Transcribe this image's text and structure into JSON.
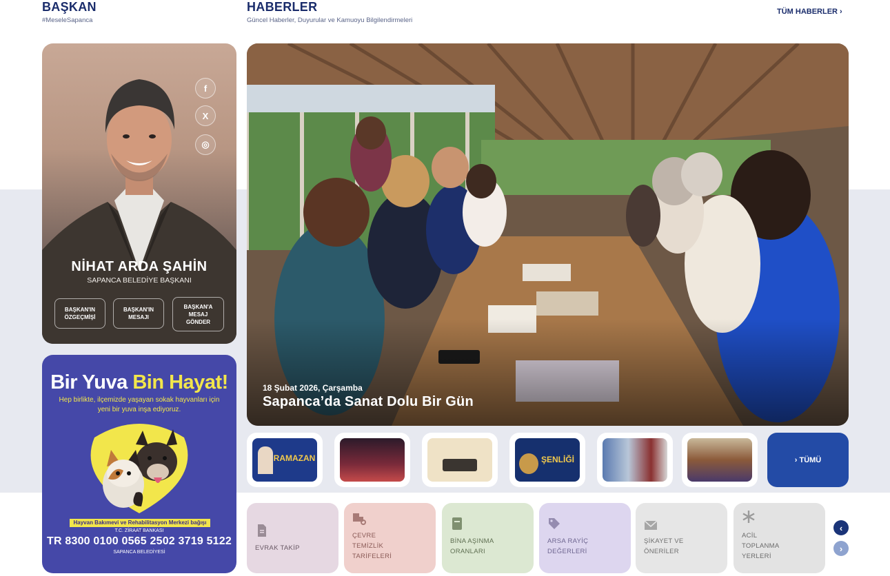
{
  "mayor_section": {
    "title": "BAŞKAN",
    "subtitle": "#MeseleSapanca"
  },
  "news_section": {
    "title": "HABERLER",
    "subtitle": "Güncel Haberler, Duyurular ve Kamuoyu Bilgilendirmeleri",
    "all_news_label": "TÜM HABERLER ›"
  },
  "mayor": {
    "name": "NİHAT ARDA ŞAHİN",
    "role": "SAPANCA BELEDİYE BAŞKANI",
    "social": {
      "facebook": "f",
      "x": "X",
      "instagram": "◎"
    },
    "buttons": [
      "BAŞKAN'IN\nÖZGEÇMİŞİ",
      "BAŞKAN'IN\nMESAJI",
      "BAŞKAN'A\nMESAJ\nGÖNDER"
    ]
  },
  "promo": {
    "title_part1": "Bir Yuva",
    "title_part2": "Bin Hayat!",
    "description": "Hep birlikte, ilçemizde yaşayan sokak hayvanları için yeni bir yuva inşa ediyoruz.",
    "footer_note": "Hayvan Bakımevi ve Rehabilitasyon Merkezi bağışı için;",
    "bank": "T.C. ZİRAAT BANKASI",
    "iban": "TR 8300 0100 0565 2502 3719 5122",
    "municipality": "SAPANCA BELEDİYESİ"
  },
  "hero": {
    "date": "18 Şubat 2026, Çarşamba",
    "title": "Sapanca’da Sanat Dolu Bir Gün"
  },
  "thumbnails": {
    "t1": "RAMAZAN",
    "t4": "ŞENLİĞİ",
    "more_label": "›  TÜMÜ"
  },
  "quick_links": [
    {
      "label": "EVRAK TAKİP",
      "icon": "document-icon"
    },
    {
      "label": "ÇEVRE\nTEMİZLİK\nTARİFELERİ",
      "icon": "truck-icon"
    },
    {
      "label": "BİNA AŞINMA\nORANLARI",
      "icon": "book-icon"
    },
    {
      "label": "ARSA RAYİÇ\nDEĞERLERİ",
      "icon": "tag-icon"
    },
    {
      "label": "ŞİKAYET VE\nÖNERİLER",
      "icon": "envelope-icon"
    },
    {
      "label": "ACİL\nTOPLANMA\nYERLERİ",
      "icon": "asterisk-icon"
    }
  ],
  "arrows": {
    "prev": "‹",
    "next": "›"
  },
  "colors": {
    "navy": "#1a2c6b",
    "band": "#e7e9f0",
    "promo": "#4548a8",
    "promo_accent": "#f2e64b",
    "more_button": "#234ba6"
  }
}
